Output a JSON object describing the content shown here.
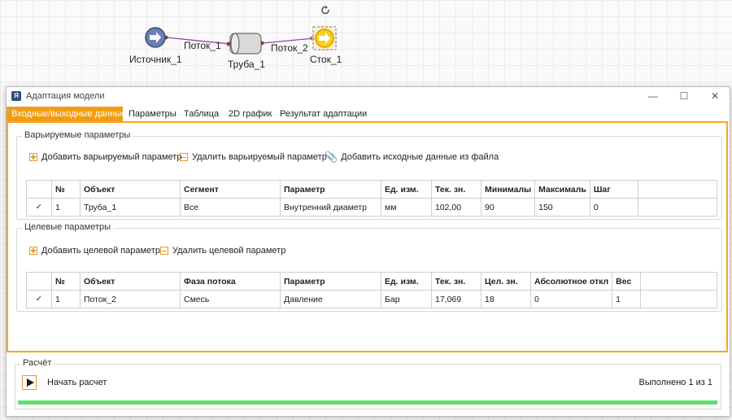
{
  "diagram": {
    "nodes": {
      "source": "Источник_1",
      "pipe": "Труба_1",
      "sink": "Сток_1"
    },
    "edges": {
      "flow1": "Поток_1",
      "flow2": "Поток_2"
    }
  },
  "window": {
    "title": "Адаптация модели",
    "controls": {
      "minimize": "—",
      "maximize": "☐",
      "close": "✕"
    }
  },
  "tabs": [
    {
      "label": "Входные/выходные данные"
    },
    {
      "label": "Параметры"
    },
    {
      "label": "Таблица"
    },
    {
      "label": "2D график"
    },
    {
      "label": "Результат адаптации"
    }
  ],
  "varied": {
    "title": "Варьируемые параметры",
    "add": "Добавить варьируемый параметр",
    "remove": "Удалить варьируемый параметр",
    "load": "Добавить исходные данные из файла",
    "columns": [
      "№",
      "Объект",
      "Сегмент",
      "Параметр",
      "Ед. изм.",
      "Тек. зн.",
      "Минималы",
      "Максималь",
      "Шаг"
    ],
    "rows": [
      {
        "check": "✓",
        "num": "1",
        "object": "Труба_1",
        "segment": "Все",
        "param": "Внутренний диаметр",
        "unit": "мм",
        "cur": "102,00",
        "min": "90",
        "max": "150",
        "step": "0"
      }
    ]
  },
  "target": {
    "title": "Целевые параметры",
    "add": "Добавить целевой параметр",
    "remove": "Удалить целевой параметр",
    "columns": [
      "№",
      "Объект",
      "Фаза потока",
      "Параметр",
      "Ед. изм.",
      "Тек. зн.",
      "Цел. зн.",
      "Абсолютное откл",
      "Вес"
    ],
    "rows": [
      {
        "check": "✓",
        "num": "1",
        "object": "Поток_2",
        "phase": "Смесь",
        "param": "Давление",
        "unit": "Бар",
        "cur": "17,069",
        "target": "18",
        "abs": "0",
        "weight": "1"
      }
    ]
  },
  "calc": {
    "title": "Расчёт",
    "start": "Начать расчет",
    "status": "Выполнено 1 из 1",
    "progress": 1.0
  },
  "colors": {
    "accent": "#f39c12",
    "progress": "#5fe06a",
    "flow_line": "#8e44ad"
  }
}
